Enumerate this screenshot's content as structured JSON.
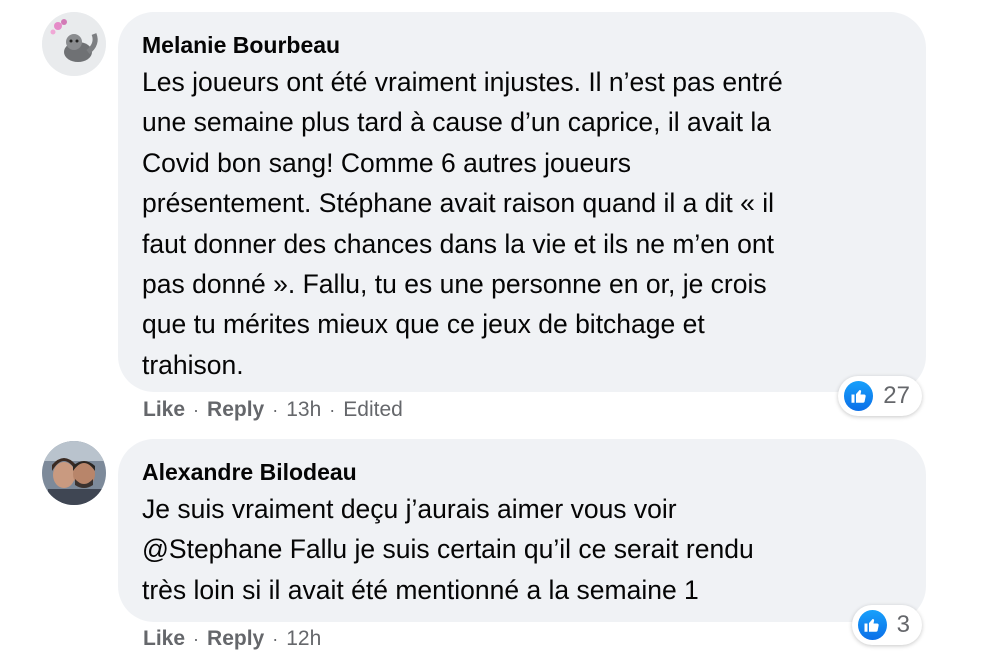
{
  "comments": [
    {
      "author": "Melanie Bourbeau",
      "text": "Les joueurs ont été vraiment injustes. Il n’est pas entré\nune semaine plus tard à cause d’un caprice, il avait la\nCovid bon sang! Comme 6 autres joueurs\nprésentement. Stéphane avait raison quand il a dit « il\nfaut donner des chances dans la vie et ils ne m’en ont\npas donné ». Fallu, tu es une personne en or, je crois\nque tu mérites mieux que ce jeux de bitchage et\ntrahison.",
      "reaction_icon": "thumbs-up-icon",
      "reaction_count": "27",
      "like_label": "Like",
      "reply_label": "Reply",
      "time": "13h",
      "edited_label": "Edited"
    },
    {
      "author": "Alexandre Bilodeau",
      "text": "Je suis vraiment deçu j’aurais aimer vous voir\n@Stephane Fallu je suis certain qu’il ce serait rendu\ntrès loin si il avait été mentionné a la semaine 1",
      "reaction_icon": "thumbs-up-icon",
      "reaction_count": "3",
      "like_label": "Like",
      "reply_label": "Reply",
      "time": "12h"
    }
  ],
  "separator": "·",
  "colors": {
    "bubble_bg": "#f0f2f5",
    "meta_text": "#65676b",
    "like_blue": "#0b6fe8"
  }
}
